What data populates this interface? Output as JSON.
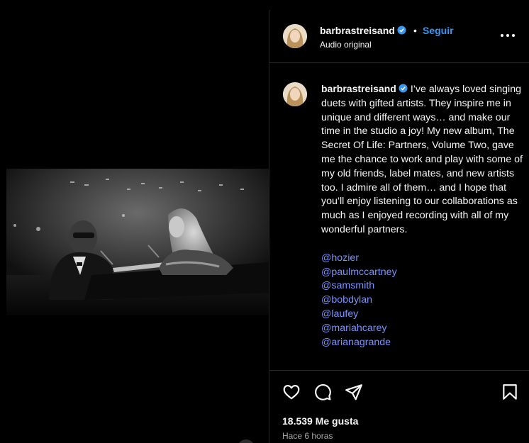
{
  "post": {
    "username": "barbrastreisand",
    "dot": "•",
    "follow_label": "Seguir",
    "audio_label": "Audio original",
    "caption_text": "I’ve always loved singing duets with gifted artists. They inspire me in unique and different ways… and make our time in the studio a joy! My new album, The Secret Of Life: Partners, Volume Two, gave me the chance to work and play with some of my old friends, label mates, and new artists too. I admire all of them… and I hope that you’ll enjoy listening to our collaborations as much as I enjoyed recording with all of my wonderful partners.",
    "mentions": [
      "@hozier",
      "@paulmccartney",
      "@samsmith",
      "@bobdylan",
      "@laufey",
      "@mariahcarey",
      "@arianagrande"
    ],
    "likes_label": "18.539 Me gusta",
    "time_label": "Hace 6 horas"
  },
  "icons": {
    "verified": "verified-badge-icon",
    "more": "more-options-icon",
    "like": "heart-icon",
    "comment": "comment-icon",
    "share": "send-icon",
    "save": "bookmark-icon"
  },
  "colors": {
    "background": "#000000",
    "link": "#3897f0",
    "mention": "#7a92ff",
    "border": "#262626",
    "muted_text": "#a8a8a8"
  }
}
